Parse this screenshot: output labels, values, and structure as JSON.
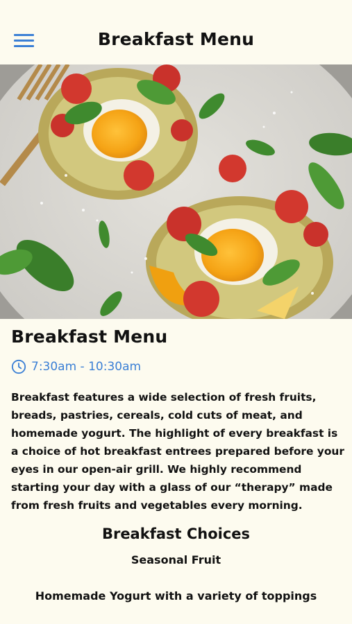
{
  "header": {
    "title": "Breakfast Menu",
    "menu_icon": "hamburger-menu-icon"
  },
  "hero": {
    "image": "breakfast-dish-photo"
  },
  "section": {
    "title": "Breakfast Menu",
    "hours_icon": "clock-icon",
    "hours": "7:30am - 10:30am",
    "description": "Breakfast features a wide selection of fresh fruits, breads, pastries, cereals, cold cuts of meat, and homemade yogurt. The highlight of every breakfast is a choice of hot breakfast entrees prepared before your eyes in our open-air grill. We highly recommend starting your day with a glass of our “therapy” made from fresh fruits and vegetables every morning."
  },
  "choices": {
    "title": "Breakfast Choices",
    "items": [
      "Seasonal Fruit",
      "Homemade Yogurt with a variety of toppings"
    ]
  },
  "colors": {
    "background": "#FDFBEF",
    "accent": "#3A7FD5",
    "text": "#111111"
  }
}
